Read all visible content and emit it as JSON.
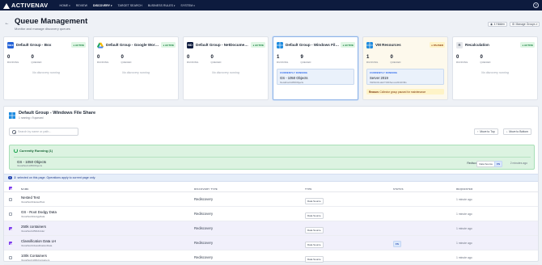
{
  "nav": {
    "brand": "ACTIVENAV",
    "items": [
      {
        "label": "HOME",
        "caret": true,
        "active": false
      },
      {
        "label": "REVIEW",
        "caret": false,
        "active": false
      },
      {
        "label": "DISCOVERY",
        "caret": true,
        "active": true
      },
      {
        "label": "TARGET SEARCH",
        "caret": false,
        "active": false
      },
      {
        "label": "BUSINESS RULES",
        "caret": true,
        "active": false
      },
      {
        "label": "SYSTEM",
        "caret": true,
        "active": false
      }
    ],
    "help_icon": "?"
  },
  "header": {
    "title": "Queue Management",
    "subtitle": "Monitor and manage discovery queues",
    "hidden_button": "4 Hidden",
    "manage_button": "Manage Groups"
  },
  "cards": [
    {
      "name": "Default Group - Box",
      "icon": "box-icon",
      "icon_text": "box",
      "icon_color": "#2463d8",
      "status": "ACTIVE",
      "running": "0",
      "queued": "0",
      "running_label": "RUNNING",
      "queued_label": "QUEUED",
      "empty": "No discovery running"
    },
    {
      "name": "Default Group - Google Works...",
      "icon": "google-drive-icon",
      "icon_text": "",
      "icon_color": "#ffffff",
      "status": "ACTIVE",
      "running": "0",
      "queued": "0",
      "running_label": "RUNNING",
      "queued_label": "QUEUED",
      "empty": "No discovery running"
    },
    {
      "name": "Default Group - NetDocuments",
      "icon": "netdocuments-icon",
      "icon_text": "ND",
      "icon_color": "#0d1b3e",
      "status": "ACTIVE",
      "running": "0",
      "queued": "0",
      "running_label": "RUNNING",
      "queued_label": "QUEUED",
      "empty": "No discovery running"
    },
    {
      "name": "Default Group - Windows File ...",
      "icon": "windows-icon",
      "icon_text": "",
      "icon_color": "#1f8ce0",
      "status": "ACTIVE",
      "running": "1",
      "queued": "9",
      "running_label": "RUNNING",
      "queued_label": "QUEUED",
      "currently_running_label": "CURRENTLY RUNNING",
      "currently_running_name": "GS - 1050 Objects",
      "currently_running_path": "\\\\localhost\\1050Objects"
    },
    {
      "name": "VM Resources",
      "icon": "windows-icon",
      "icon_text": "",
      "icon_color": "#1f8ce0",
      "status": "PAUSED",
      "running": "1",
      "queued": "0",
      "running_label": "RUNNING",
      "queued_label": "QUEUED",
      "currently_running_label": "CURRENTLY RUNNING",
      "currently_running_name": "Server 2019",
      "currently_running_path": "\\\\WINCOLLECTOR\\Server2019\\VMs",
      "reason_label": "Reason:",
      "reason_text": "Collector group paused for maintenance"
    },
    {
      "name": "Recalculation",
      "icon": "recalculation-icon",
      "icon_text": "R",
      "icon_color": "#e5e7eb",
      "status": "ACTIVE",
      "running": "0",
      "queued": "0",
      "running_label": "RUNNING",
      "queued_label": "QUEUED",
      "empty": "No discovery running"
    }
  ],
  "detail": {
    "title": "Default Group - Windows File Share",
    "summary": "1 running • 9 queued",
    "search_placeholder": "Search by name or path...",
    "move_top": "Move to Top",
    "move_bottom": "Move to Bottom",
    "running_header": "Currently Running (1)",
    "running_item": {
      "name": "GS - 1050 Objects",
      "path": "\\\\localhost\\1050Objects",
      "type": "Rediscovery",
      "chip": "Data Source",
      "status_chip": "FS",
      "time": "2 minutes ago"
    },
    "selection": {
      "count": "2",
      "text": "selected on this page. Operations apply to current page only."
    },
    "columns": [
      "NAME",
      "DISCOVERY TYPE",
      "TYPE",
      "STATUS",
      "REQUESTED"
    ],
    "rows": [
      {
        "name": "Nested Test",
        "path": "\\\\localhost\\NestedTest",
        "type": "Rediscovery",
        "chip": "Data Source",
        "status": "",
        "time": "1 minute ago",
        "selected": false
      },
      {
        "name": "GS - Root Dodgy Data",
        "path": "\\\\localhost\\DodgyData",
        "type": "Rediscovery",
        "chip": "Data Source",
        "status": "",
        "time": "1 minute ago",
        "selected": false
      },
      {
        "name": "250k containers",
        "path": "\\\\localhost\\250kFolder",
        "type": "Rediscovery",
        "chip": "Data Source",
        "status": "",
        "time": "1 minute ago",
        "selected": true
      },
      {
        "name": "Classification Data LH",
        "path": "\\\\localhost\\ClassificationData",
        "type": "Rediscovery",
        "chip": "Data Source",
        "status": "FS",
        "time": "1 minute ago",
        "selected": true
      },
      {
        "name": "100k Containers",
        "path": "\\\\localhost\\100kContainers",
        "type": "Rediscovery",
        "chip": "Data Source",
        "status": "",
        "time": "1 minute ago",
        "selected": false
      }
    ]
  }
}
